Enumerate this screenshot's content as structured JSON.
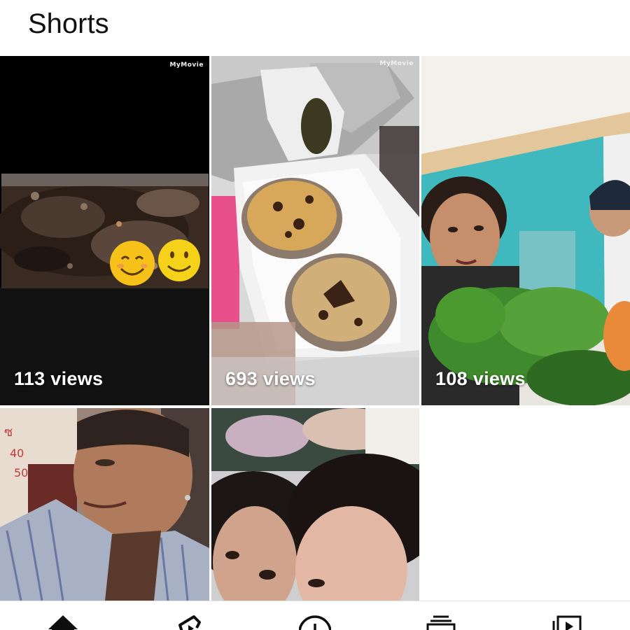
{
  "header": {
    "title": "Shorts"
  },
  "shorts": [
    {
      "views": "113 views",
      "watermark": "MyMovie"
    },
    {
      "views": "693 views",
      "watermark": "MyMovie"
    },
    {
      "views": "108 views"
    },
    {},
    {}
  ],
  "navbar": {
    "items": [
      {
        "icon": "home-icon"
      },
      {
        "icon": "shorts-icon"
      },
      {
        "icon": "create-icon"
      },
      {
        "icon": "subscriptions-icon"
      },
      {
        "icon": "library-icon"
      }
    ]
  }
}
